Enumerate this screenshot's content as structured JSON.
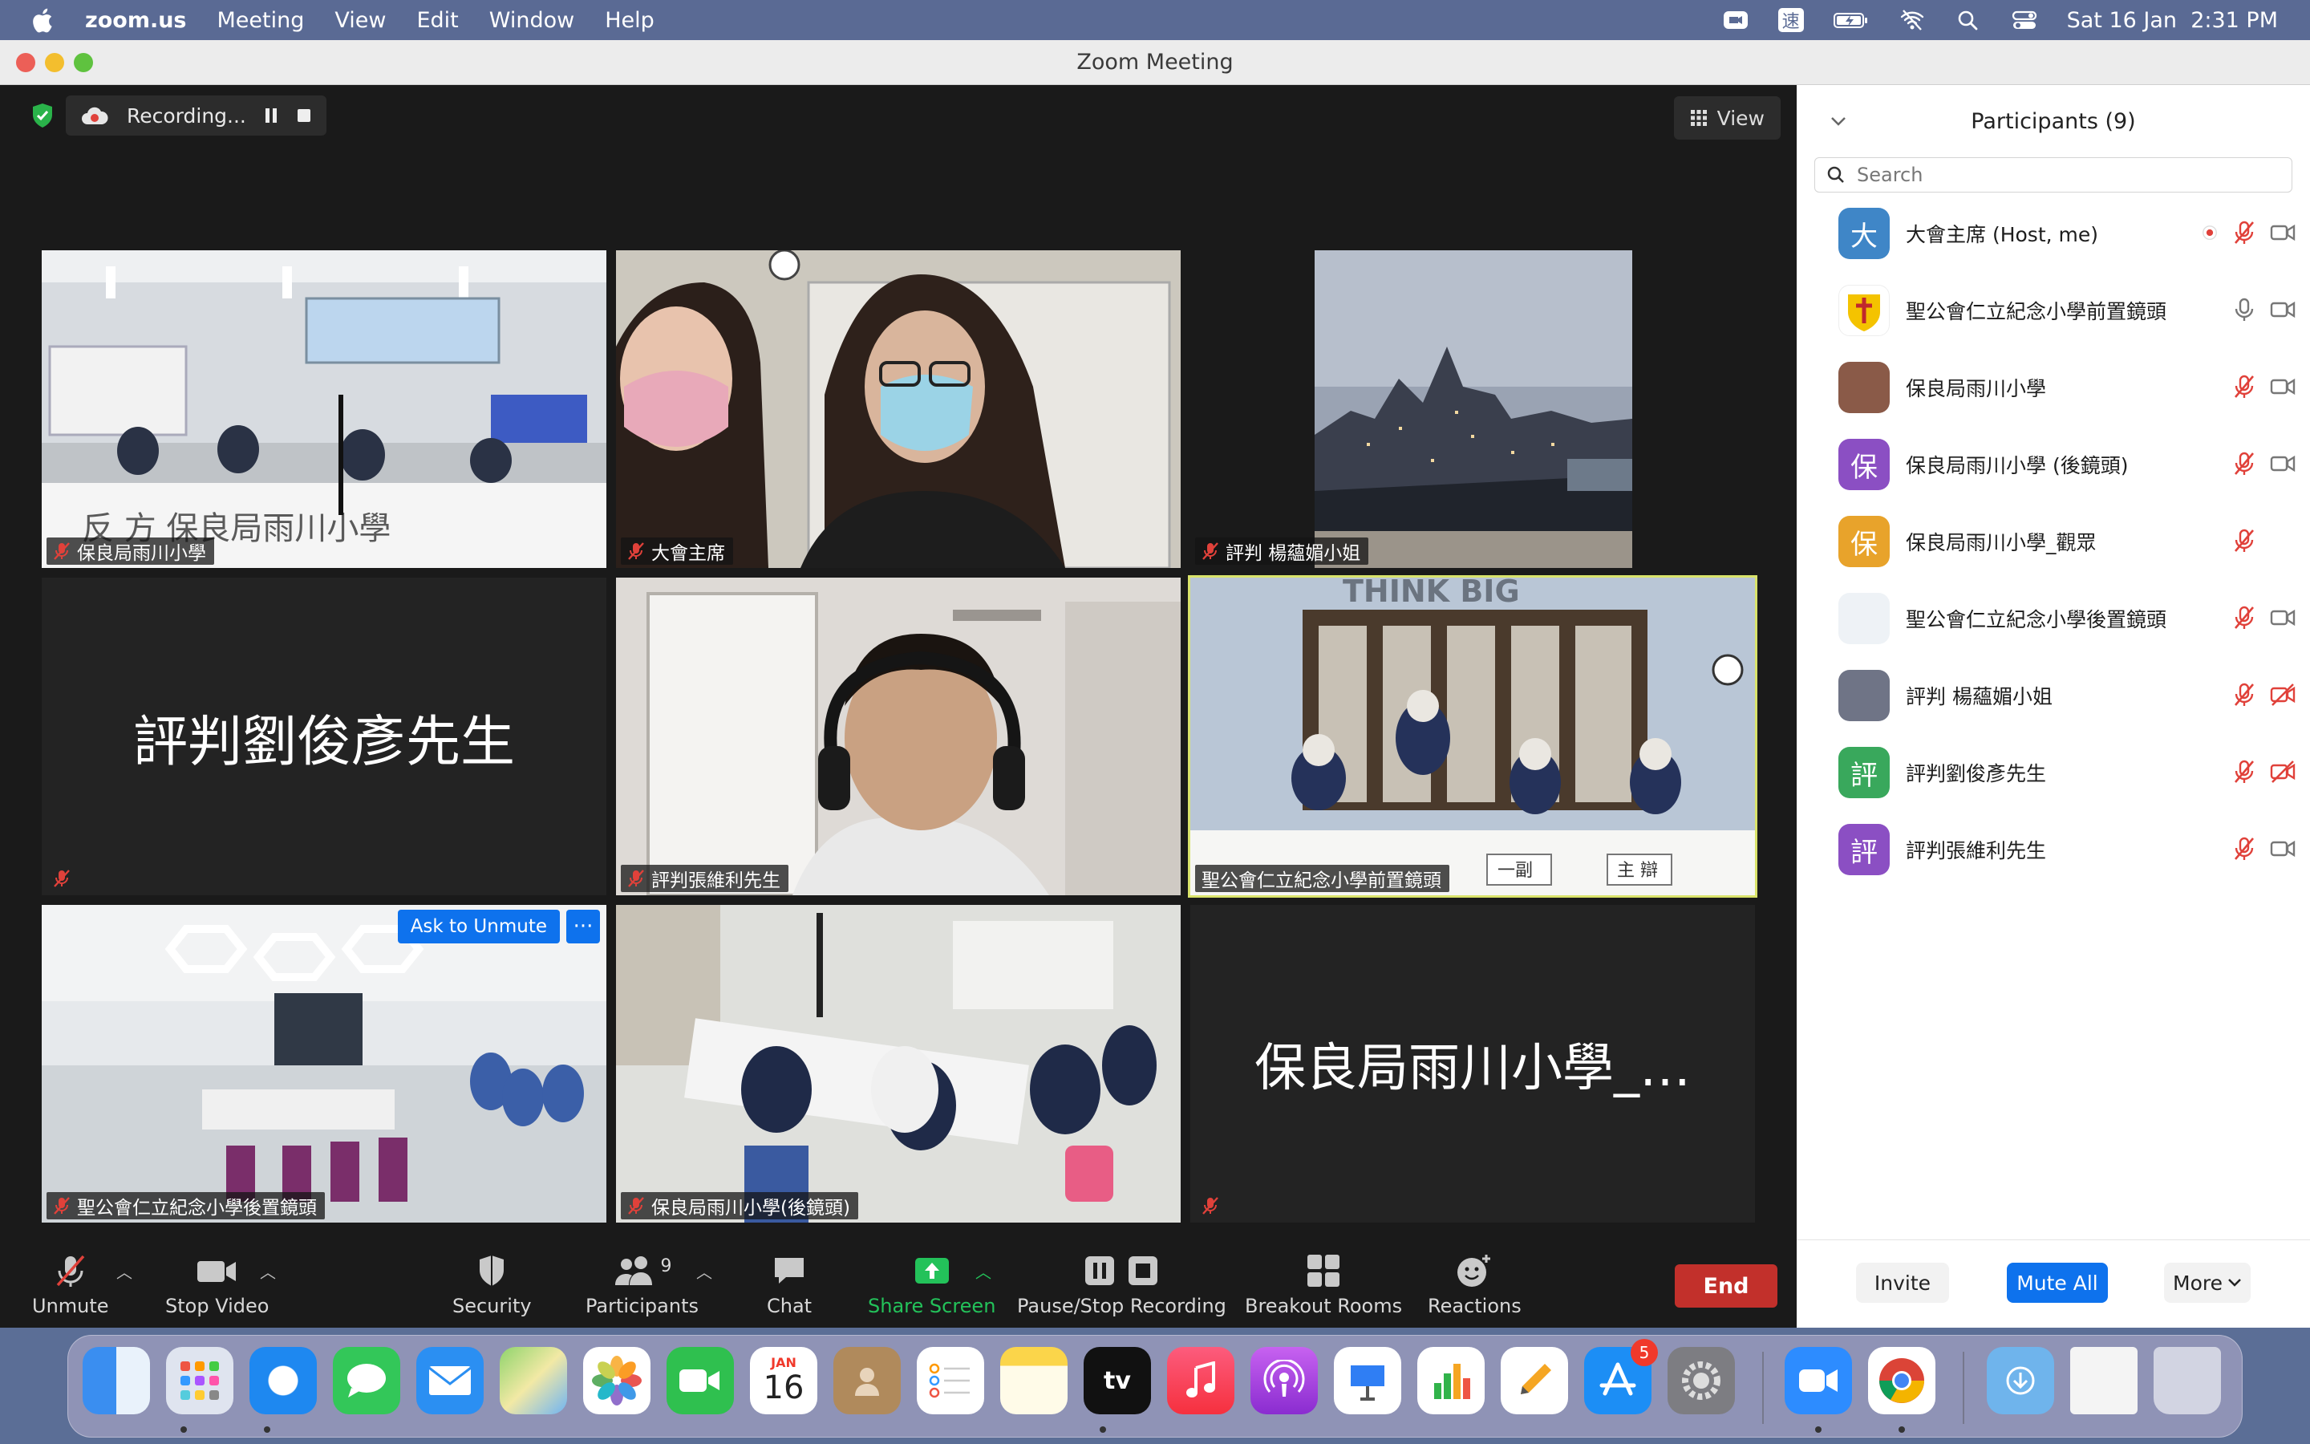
{
  "menubar": {
    "app": "zoom.us",
    "items": [
      "Meeting",
      "View",
      "Edit",
      "Window",
      "Help"
    ],
    "clock": "Sat 16 Jan  2:31 PM",
    "input_method": "速"
  },
  "window": {
    "title": "Zoom Meeting"
  },
  "recording": {
    "label": "Recording..."
  },
  "view_button": "View",
  "tiles": [
    {
      "label": "保良局雨川小學",
      "muted": true
    },
    {
      "label": "大會主席",
      "muted": true
    },
    {
      "label": "評判 楊蘊媚小姐",
      "muted": true
    },
    {
      "label": "",
      "big_name": "評判劉俊彥先生",
      "muted": true
    },
    {
      "label": "評判張維利先生",
      "muted": true
    },
    {
      "label": "聖公會仁立紀念小學前置鏡頭",
      "muted": false,
      "active_speaker": true
    },
    {
      "label": "聖公會仁立紀念小學後置鏡頭",
      "muted": true
    },
    {
      "label": "保良局雨川小學(後鏡頭)",
      "muted": true
    },
    {
      "label": "",
      "big_name": "保良局雨川小學_…",
      "muted": true
    }
  ],
  "tile_overlay": {
    "ask_to_unmute": "Ask to Unmute",
    "more": "···"
  },
  "scene_text": {
    "banner_left": "反 方  保良局雨川小學",
    "banner_right": "THINK BIG",
    "desk_signs": [
      "一副",
      "主 辯"
    ]
  },
  "toolbar": {
    "unmute": "Unmute",
    "stop_video": "Stop Video",
    "security": "Security",
    "participants": "Participants",
    "participant_count": "9",
    "chat": "Chat",
    "share_screen": "Share Screen",
    "pause_stop_recording": "Pause/Stop Recording",
    "breakout_rooms": "Breakout Rooms",
    "reactions": "Reactions",
    "end": "End"
  },
  "panel": {
    "title": "Participants (9)",
    "search_placeholder": "Search",
    "participants": [
      {
        "initial": "大",
        "name": "大會主席 (Host, me)",
        "avatar_color": "#3f86c7",
        "recording": true,
        "mic": "muted",
        "video": "on"
      },
      {
        "initial": "",
        "name": "聖公會仁立紀念小學前置鏡頭",
        "avatar_color": "#ffffff",
        "recording": false,
        "mic": "on",
        "video": "on"
      },
      {
        "initial": "",
        "name": "保良局雨川小學",
        "avatar_color": "#8a5a48",
        "recording": false,
        "mic": "muted",
        "video": "on"
      },
      {
        "initial": "保",
        "name": "保良局雨川小學 (後鏡頭)",
        "avatar_color": "#8b4fc3",
        "recording": false,
        "mic": "muted",
        "video": "on"
      },
      {
        "initial": "保",
        "name": "保良局雨川小學_觀眾",
        "avatar_color": "#e8a32b",
        "recording": false,
        "mic": "muted",
        "video": "none"
      },
      {
        "initial": "",
        "name": "聖公會仁立紀念小學後置鏡頭",
        "avatar_color": "#eef2f6",
        "recording": false,
        "mic": "muted",
        "video": "on"
      },
      {
        "initial": "",
        "name": "評判 楊蘊媚小姐",
        "avatar_color": "#6f7486",
        "recording": false,
        "mic": "muted",
        "video": "off"
      },
      {
        "initial": "評",
        "name": "評判劉俊彥先生",
        "avatar_color": "#39a85c",
        "recording": false,
        "mic": "muted",
        "video": "off"
      },
      {
        "initial": "評",
        "name": "評判張維利先生",
        "avatar_color": "#8b4fc3",
        "recording": false,
        "mic": "muted",
        "video": "on"
      }
    ],
    "footer": {
      "invite": "Invite",
      "mute_all": "Mute All",
      "more": "More"
    }
  },
  "dock": {
    "calendar_month": "JAN",
    "calendar_day": "16",
    "tv_label": "tv",
    "appstore_badge": "5"
  },
  "colors": {
    "zoom_blue": "#0e72ed",
    "end_red": "#c2302b",
    "share_green": "#23c25a",
    "muted_red": "#e0413a",
    "speaker_outline": "#d9e36b"
  }
}
